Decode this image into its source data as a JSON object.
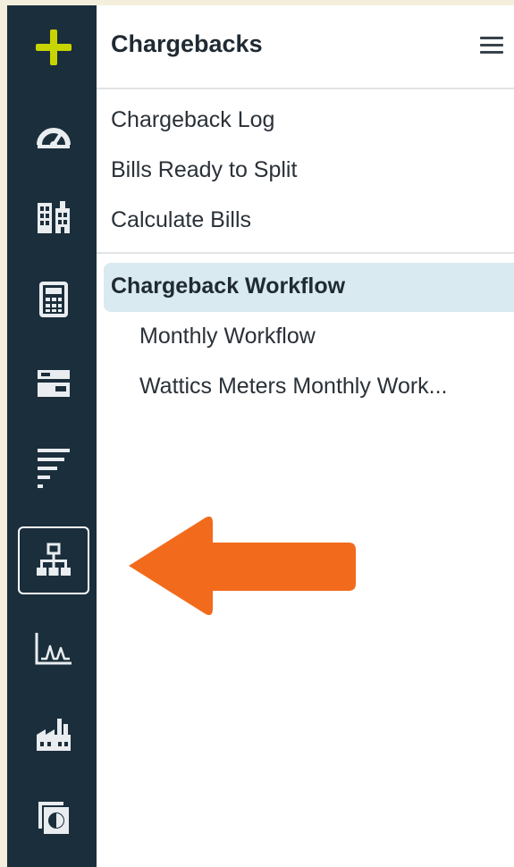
{
  "panel": {
    "title": "Chargebacks"
  },
  "menu": {
    "items": [
      {
        "label": "Chargeback Log"
      },
      {
        "label": "Bills Ready to Split"
      },
      {
        "label": "Calculate Bills"
      }
    ],
    "section": {
      "label": "Chargeback Workflow",
      "items": [
        {
          "label": "Monthly Workflow"
        },
        {
          "label": "Wattics Meters Monthly Work..."
        }
      ]
    }
  },
  "colors": {
    "rail": "#1b2e3c",
    "accent_plus": "#c8d400",
    "active_section_bg": "#d9eaf0",
    "arrow": "#f26b1d"
  },
  "rail_icons": [
    "plus-icon",
    "dashboard-gauge-icon",
    "buildings-icon",
    "calculator-icon",
    "bill-card-icon",
    "list-lines-icon",
    "org-hierarchy-icon",
    "line-chart-icon",
    "factory-icon",
    "pie-report-icon"
  ]
}
